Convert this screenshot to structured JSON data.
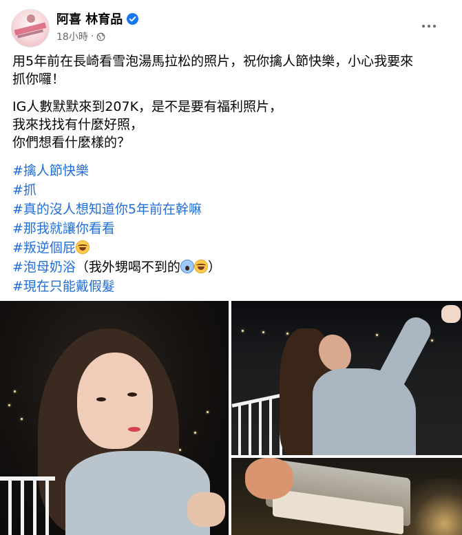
{
  "post": {
    "page_name": "阿喜 林育品",
    "timestamp": "18小時",
    "separator": "·",
    "body": {
      "para1": [
        "用5年前在長崎看雪泡湯馬拉松的照片，祝你擒人節快樂，小心我要來",
        "抓你囉！"
      ],
      "para2": [
        "IG人數默默來到207K，是不是要有福利照片，",
        "我來找找有什麼好照，",
        "你們想看什麼樣的？"
      ]
    },
    "hashtags": [
      "#擒人節快樂",
      "#抓",
      "#真的沒人想知道你5年前在幹嘛",
      "#那我就讓你看看",
      "#叛逆個屁"
    ],
    "hashtag6": {
      "tag": "#泡母奶浴",
      "text": "（我外甥喝不到的",
      "close": "）"
    },
    "hashtag7": "#現在只能戴假髮",
    "icons": {
      "verified": "verified-badge-icon",
      "privacy": "globe-icon",
      "more": "more-options-icon",
      "emoji_laugh": "rolling-laughing-emoji",
      "emoji_scream": "screaming-face-emoji"
    },
    "colors": {
      "link": "#216fdb",
      "meta": "#65676b",
      "verified": "#1877f2"
    }
  }
}
